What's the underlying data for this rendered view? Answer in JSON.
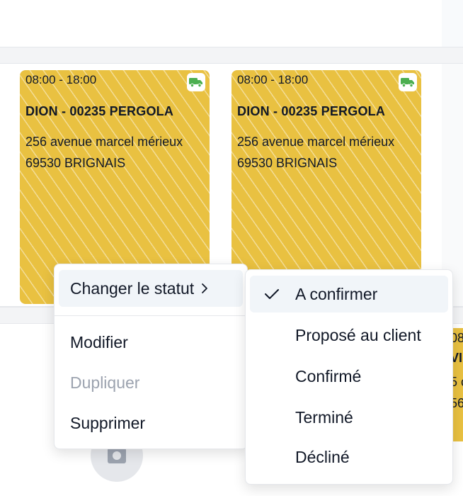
{
  "cards": [
    {
      "time": "08:00 - 18:00",
      "name": "DION - 00235 PERGOLA",
      "address": "256 avenue marcel mérieux",
      "city": "69530 BRIGNAIS",
      "icon": "truck-icon"
    },
    {
      "time": "08:00 - 18:00",
      "name": "DION - 00235 PERGOLA",
      "address": "256 avenue marcel mérieux",
      "city": "69530 BRIGNAIS",
      "icon": "truck-icon"
    }
  ],
  "partial_card": {
    "time": "08",
    "name": "VI",
    "address": "5 c",
    "city": "56"
  },
  "context_menu": {
    "change_status": "Changer le statut",
    "modify": "Modifier",
    "duplicate": "Dupliquer",
    "delete": "Supprimer"
  },
  "status_submenu": {
    "selected": "A confirmer",
    "items": [
      "A confirmer",
      "Proposé au client",
      "Confirmé",
      "Terminé",
      "Décliné"
    ]
  },
  "colors": {
    "card_yellow": "#e9c141",
    "truck_green": "#4caf50",
    "menu_highlight": "#f1f5f9",
    "disabled_text": "#9ca3af"
  }
}
